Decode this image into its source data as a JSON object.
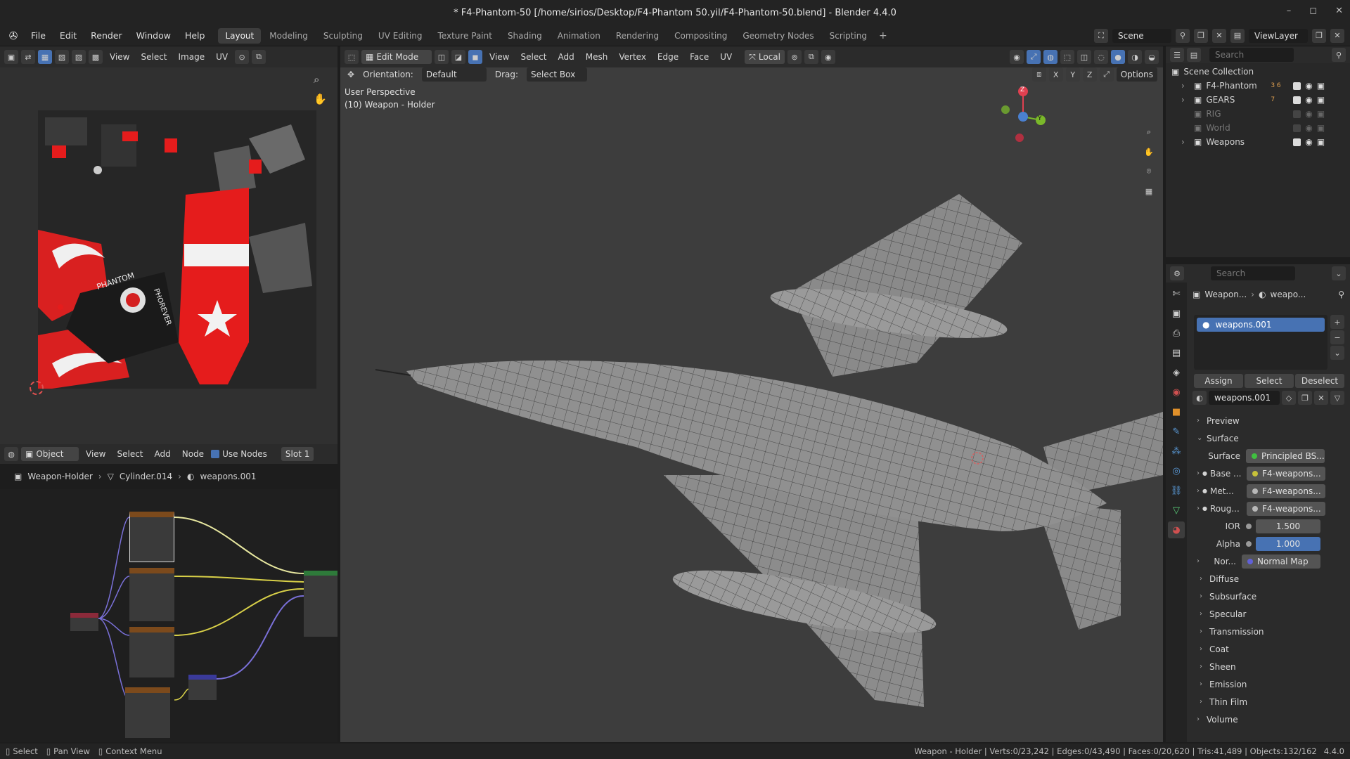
{
  "window": {
    "title": "* F4-Phantom-50 [/home/sirios/Desktop/F4-Phantom 50.yil/F4-Phantom-50.blend] - Blender 4.4.0",
    "minimize": "–",
    "maximize": "◻",
    "close": "✕"
  },
  "menu": [
    "File",
    "Edit",
    "Render",
    "Window",
    "Help"
  ],
  "workspaces": [
    {
      "label": "Layout",
      "active": true
    },
    {
      "label": "Modeling"
    },
    {
      "label": "Sculpting"
    },
    {
      "label": "UV Editing"
    },
    {
      "label": "Texture Paint"
    },
    {
      "label": "Shading"
    },
    {
      "label": "Animation"
    },
    {
      "label": "Rendering"
    },
    {
      "label": "Compositing"
    },
    {
      "label": "Geometry Nodes"
    },
    {
      "label": "Scripting"
    }
  ],
  "add_workspace": "+",
  "scene": {
    "name": "Scene",
    "view_layer": "ViewLayer"
  },
  "uv_editor": {
    "menus": [
      "View",
      "Select",
      "Image",
      "UV"
    ]
  },
  "node_editor": {
    "type": "Object",
    "menus": [
      "View",
      "Select",
      "Add",
      "Node"
    ],
    "use_nodes_label": "Use Nodes",
    "slot": "Slot 1",
    "breadcrumb": [
      "Weapon-Holder",
      "Cylinder.014",
      "weapons.001"
    ]
  },
  "viewport": {
    "mode": "Edit Mode",
    "menus": [
      "View",
      "Select",
      "Add",
      "Mesh",
      "Vertex",
      "Edge",
      "Face",
      "UV"
    ],
    "pivot": "Local",
    "orientation_label": "Orientation:",
    "orientation": "Default",
    "drag_label": "Drag:",
    "drag": "Select Box",
    "options": "Options",
    "axes": [
      "X",
      "Y",
      "Z"
    ],
    "overlay_line1": "User Perspective",
    "overlay_line2": "(10) Weapon - Holder",
    "gizmo": {
      "x": "X",
      "y": "Y",
      "z": "Z"
    }
  },
  "outliner": {
    "search_placeholder": "Search",
    "root": "Scene Collection",
    "items": [
      {
        "name": "F4-Phantom",
        "dim": false,
        "badge": "3 6"
      },
      {
        "name": "GEARS",
        "dim": false,
        "badge": "7"
      },
      {
        "name": "RIG",
        "dim": true,
        "badge": ""
      },
      {
        "name": "World",
        "dim": true,
        "badge": ""
      },
      {
        "name": "Weapons",
        "dim": false,
        "badge": ""
      }
    ]
  },
  "properties": {
    "search_placeholder": "Search",
    "breadcrumb": [
      "Weapon...",
      "weapo..."
    ],
    "material_slot": "weapons.001",
    "buttons": [
      "Assign",
      "Select",
      "Deselect"
    ],
    "material_name": "weapons.001",
    "sections_top": [
      "Preview",
      "Surface"
    ],
    "surface": {
      "label": "Surface",
      "value": "Principled BS..."
    },
    "inputs": [
      {
        "label": "Base ...",
        "value": "F4-weapons...",
        "color": "#c8c23a"
      },
      {
        "label": "Met...",
        "value": "F4-weapons...",
        "color": "#b8b8b8"
      },
      {
        "label": "Roug...",
        "value": "F4-weapons...",
        "color": "#b8b8b8"
      }
    ],
    "ior": {
      "label": "IOR",
      "value": "1.500"
    },
    "alpha": {
      "label": "Alpha",
      "value": "1.000"
    },
    "normal": {
      "label": "Nor...",
      "value": "Normal Map"
    },
    "subsections": [
      "Diffuse",
      "Subsurface",
      "Specular",
      "Transmission",
      "Coat",
      "Sheen",
      "Emission",
      "Thin Film"
    ],
    "volume": "Volume"
  },
  "status": {
    "select": "Select",
    "pan": "Pan View",
    "context": "Context Menu",
    "stats": "Weapon - Holder | Verts:0/23,242 | Edges:0/43,490 | Faces:0/20,620 | Tris:41,489 | Objects:132/162",
    "version": "4.4.0"
  },
  "colors": {
    "accent": "#4772b3",
    "bg": "#1d1d1d",
    "panel": "#2b2b2b",
    "viewport": "#3d3d3d"
  }
}
